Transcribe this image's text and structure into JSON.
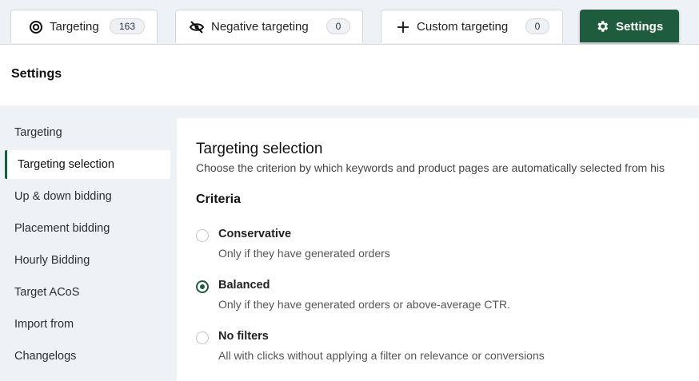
{
  "tabs": [
    {
      "label": "Targeting",
      "count": "163",
      "icon": "target-icon"
    },
    {
      "label": "Negative targeting",
      "count": "0",
      "icon": "eye-off-icon"
    },
    {
      "label": "Custom targeting",
      "count": "0",
      "icon": "plus-icon"
    },
    {
      "label": "Settings",
      "icon": "gear-icon",
      "active": true
    }
  ],
  "header": {
    "title": "Settings"
  },
  "sidebar": {
    "items": [
      {
        "label": "Targeting"
      },
      {
        "label": "Targeting selection",
        "active": true
      },
      {
        "label": "Up & down bidding"
      },
      {
        "label": "Placement bidding"
      },
      {
        "label": "Hourly Bidding"
      },
      {
        "label": "Target ACoS"
      },
      {
        "label": "Import from"
      },
      {
        "label": "Changelogs"
      }
    ]
  },
  "panel": {
    "title": "Targeting selection",
    "description": "Choose the criterion by which keywords and product pages are automatically selected from his",
    "criteria_heading": "Criteria",
    "options": [
      {
        "label": "Conservative",
        "description": "Only if they have generated orders",
        "selected": false
      },
      {
        "label": "Balanced",
        "description": "Only if they have generated orders or above-average CTR.",
        "selected": true
      },
      {
        "label": "No filters",
        "description": "All with clicks without applying a filter on relevance or conversions",
        "selected": false
      }
    ]
  },
  "colors": {
    "accent": "#1f5c3e",
    "background": "#eef1f5"
  }
}
